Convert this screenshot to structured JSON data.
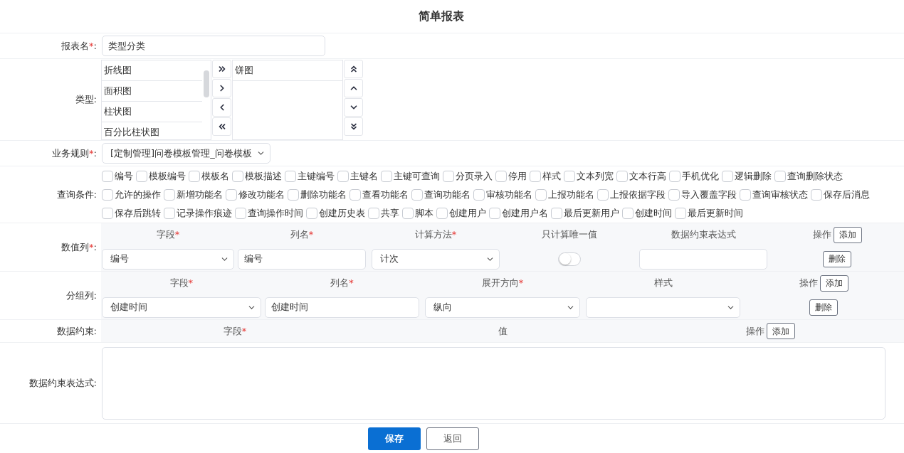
{
  "title": "简单报表",
  "report_name": {
    "label": "报表名",
    "mark": "*",
    "suffix": ":",
    "value": "类型分类"
  },
  "type": {
    "label": "类型",
    "suffix": ":",
    "available": [
      "折线图",
      "面积图",
      "柱状图",
      "百分比柱状图"
    ],
    "selected": [
      "饼图"
    ]
  },
  "rule": {
    "label": "业务规则",
    "mark": "*",
    "suffix": ":",
    "value": "[定制管理]问卷模板管理_问卷模板"
  },
  "query": {
    "label": "查询条件",
    "suffix": ":",
    "options": [
      {
        "label": "编号",
        "checked": false
      },
      {
        "label": "模板编号",
        "checked": false
      },
      {
        "label": "模板名",
        "checked": false
      },
      {
        "label": "模板描述",
        "checked": false
      },
      {
        "label": "主键编号",
        "checked": false
      },
      {
        "label": "主键名",
        "checked": false
      },
      {
        "label": "主键可查询",
        "checked": false
      },
      {
        "label": "分页录入",
        "checked": false
      },
      {
        "label": "停用",
        "checked": false
      },
      {
        "label": "样式",
        "checked": false
      },
      {
        "label": "文本列宽",
        "checked": false
      },
      {
        "label": "文本行高",
        "checked": false
      },
      {
        "label": "手机优化",
        "checked": false
      },
      {
        "label": "逻辑删除",
        "checked": false
      },
      {
        "label": "查询删除状态",
        "checked": false
      },
      {
        "label": "允许的操作",
        "checked": false
      },
      {
        "label": "新增功能名",
        "checked": false
      },
      {
        "label": "修改功能名",
        "checked": false
      },
      {
        "label": "删除功能名",
        "checked": false
      },
      {
        "label": "查看功能名",
        "checked": false
      },
      {
        "label": "查询功能名",
        "checked": false
      },
      {
        "label": "审核功能名",
        "checked": false
      },
      {
        "label": "上报功能名",
        "checked": false
      },
      {
        "label": "上报依据字段",
        "checked": false
      },
      {
        "label": "导入覆盖字段",
        "checked": false
      },
      {
        "label": "查询审核状态",
        "checked": false
      },
      {
        "label": "保存后消息",
        "checked": false
      },
      {
        "label": "保存后跳转",
        "checked": false
      },
      {
        "label": "记录操作痕迹",
        "checked": false
      },
      {
        "label": "查询操作时间",
        "checked": false
      },
      {
        "label": "创建历史表",
        "checked": false
      },
      {
        "label": "共享",
        "checked": false
      },
      {
        "label": "脚本",
        "checked": false
      },
      {
        "label": "创建用户",
        "checked": false
      },
      {
        "label": "创建用户名",
        "checked": false
      },
      {
        "label": "最后更新用户",
        "checked": false
      },
      {
        "label": "创建时间",
        "checked": false
      },
      {
        "label": "最后更新时间",
        "checked": false
      }
    ]
  },
  "numeric_columns": {
    "label": "数值列",
    "mark": "*",
    "suffix": ":",
    "headers": [
      {
        "label": "字段",
        "mark": "*"
      },
      {
        "label": "列名",
        "mark": "*"
      },
      {
        "label": "计算方法",
        "mark": "*"
      },
      {
        "label": "只计算唯一值"
      },
      {
        "label": "数据约束表达式"
      }
    ],
    "action_header": "操作",
    "add_button": "添加",
    "rows": [
      {
        "field": "编号",
        "name": "编号",
        "method": "计次",
        "unique_only": false,
        "delete_button": "删除"
      }
    ]
  },
  "group_columns": {
    "label": "分组列",
    "suffix": ":",
    "headers": [
      {
        "label": "字段",
        "mark": "*"
      },
      {
        "label": "列名",
        "mark": "*"
      },
      {
        "label": "展开方向",
        "mark": "*"
      },
      {
        "label": "样式"
      }
    ],
    "action_header": "操作",
    "add_button": "添加",
    "rows": [
      {
        "field": "创建时间",
        "name": "创建时间",
        "direction": "纵向",
        "delete_button": "删除"
      }
    ]
  },
  "constraint": {
    "label": "数据约束",
    "suffix": ":",
    "headers": [
      {
        "label": "字段",
        "mark": "*"
      },
      {
        "label": "值"
      }
    ],
    "action_header": "操作",
    "add_button": "添加"
  },
  "expression": {
    "label": "数据约束表达式",
    "suffix": ":"
  },
  "buttons": {
    "save": "保存",
    "back": "返回"
  }
}
